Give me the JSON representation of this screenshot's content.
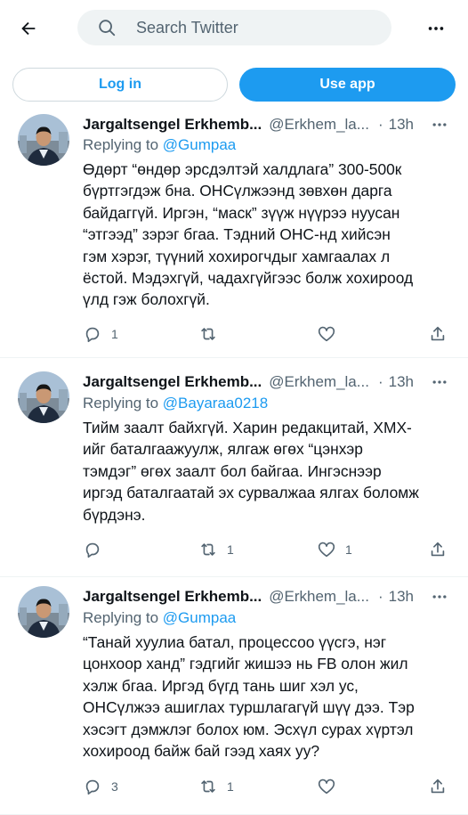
{
  "topbar": {
    "search_placeholder": "Search Twitter",
    "icons": {
      "back": "back-arrow-icon",
      "search": "search-icon",
      "more": "more-horizontal-icon"
    }
  },
  "auth": {
    "login_label": "Log in",
    "use_app_label": "Use app"
  },
  "colors": {
    "accent": "#1d9bf0",
    "text": "#0f1419",
    "muted": "#536471",
    "border": "#eff3f4"
  },
  "tweets": [
    {
      "name": "Jargaltsengel Erkhemb...",
      "handle": "@Erkhem_la...",
      "time": "13h",
      "replying_label": "Replying to",
      "replying_to": "@Gumpaa",
      "lines": [
        "Өдөрт “өндөр эрсдэлтэй халдлага” 300-500к",
        "бүртгэгдэж бна. ОНСүлжээнд зөвхөн дарга",
        "байдаггүй. Иргэн, “маск” зүүж нүүрээ нуусан",
        "“этгээд” зэрэг бгаа. Тэдний ОНС-нд хийсэн",
        "гэм хэрэг, түүний хохирогчдыг хамгаалах л",
        "ёстой. Мэдэхгүй, чадахгүйгээс болж хохироод",
        "үлд гэж болохгүй."
      ],
      "replies": "1",
      "retweets": "",
      "likes": ""
    },
    {
      "name": "Jargaltsengel Erkhemb...",
      "handle": "@Erkhem_la...",
      "time": "13h",
      "replying_label": "Replying to",
      "replying_to": "@Bayaraa0218",
      "lines": [
        "Тийм заалт байхгүй. Харин редакцитай, ХМХ-",
        "ийг баталгаажуулж, ялгаж өгөх “цэнхэр",
        "тэмдэг” өгөх заалт бол байгаа. Ингэснээр",
        "иргэд баталгаатай эх сурвалжаа ялгах боломж",
        "бүрдэнэ."
      ],
      "replies": "",
      "retweets": "1",
      "likes": "1"
    },
    {
      "name": "Jargaltsengel Erkhemb...",
      "handle": "@Erkhem_la...",
      "time": "13h",
      "replying_label": "Replying to",
      "replying_to": "@Gumpaa",
      "lines": [
        "“Танай хуулиа батал, процессоо үүсгэ, нэг",
        "цонхоор ханд” гэдгийг жишээ нь FB олон жил",
        "хэлж бгаа. Иргэд бүгд тань шиг хэл ус,",
        "ОНСүлжээ ашиглах туршлагагүй шүү дээ. Тэр",
        "хэсэгт дэмжлэг болох юм. Эсхүл сурах хүртэл",
        "хохироод байж бай гээд хаях уу?"
      ],
      "replies": "3",
      "retweets": "1",
      "likes": ""
    }
  ]
}
